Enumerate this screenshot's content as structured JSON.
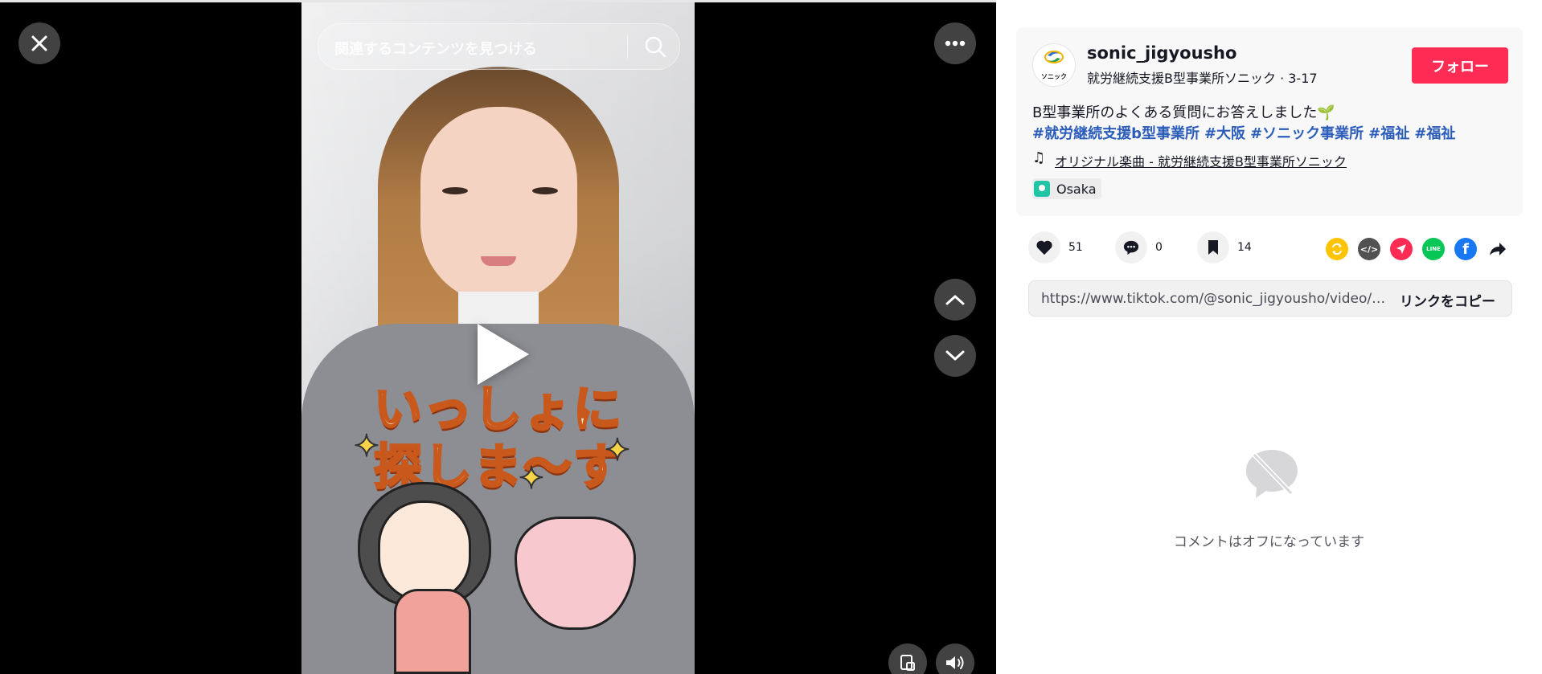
{
  "video": {
    "search_placeholder": "関連するコンテンツを見つける",
    "overlay_line1": "いっしょに",
    "overlay_line2": "探しま～す",
    "icons": {
      "close": "close-icon",
      "more": "more-icon",
      "search": "search-icon",
      "play": "play-icon",
      "up": "chevron-up-icon",
      "down": "chevron-down-icon",
      "pip": "picture-in-picture-icon",
      "volume": "volume-icon"
    }
  },
  "author": {
    "username": "sonic_jigyousho",
    "display_name": "就労継続支援B型事業所ソニック",
    "separator": " · ",
    "date": "3-17",
    "avatar_text": "ソニック",
    "follow_label": "フォロー"
  },
  "post": {
    "description": "B型事業所のよくある質問にお答えしました🌱",
    "hashtags": [
      "#就労継続支援b型事業所",
      "#大阪",
      "#ソニック事業所",
      "#福祉",
      "#福祉"
    ],
    "music": "オリジナル楽曲 - 就労継続支援B型事業所ソニック",
    "location": "Osaka"
  },
  "actions": {
    "likes": "51",
    "comments": "0",
    "saves": "14"
  },
  "share": {
    "icons": [
      "repost-icon",
      "embed-icon",
      "send-icon",
      "line-icon",
      "facebook-icon",
      "share-arrow-icon"
    ],
    "colors": {
      "repost": "#ffc300",
      "embed": "#525252",
      "send": "#fe2c55",
      "line": "#06c755",
      "facebook": "#1877f2"
    }
  },
  "link": {
    "url": "https://www.tiktok.com/@sonic_jigyousho/video/7...",
    "copy_label": "リンクをコピー"
  },
  "comments": {
    "off_message": "コメントはオフになっています"
  },
  "colors": {
    "accent": "#fe2c55",
    "hashtag": "#2b5db9"
  }
}
